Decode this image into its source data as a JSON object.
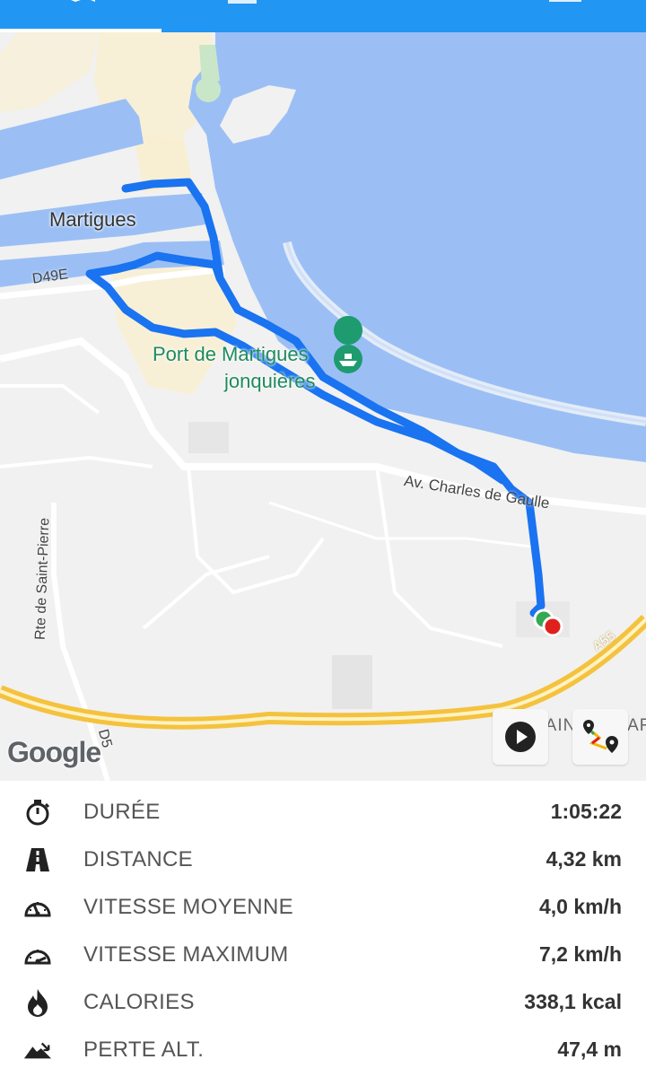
{
  "tabs": [
    {
      "icon": "map-icon"
    },
    {
      "icon": "list-icon"
    },
    {
      "icon": "chart-icon"
    },
    {
      "icon": "photo-icon"
    }
  ],
  "map": {
    "labels": {
      "martigues": "Martigues",
      "d49e": "D49E",
      "port_line1": "Port de Martigues",
      "port_line2": "jonquières",
      "avenue": "Av. Charles de Gaulle",
      "rte": "Rte de Saint-Pierre",
      "d5": "D5",
      "a55": "A55",
      "saint_lazare": "SAINT-LAZARE"
    },
    "google": "Google",
    "play_button": "play-icon",
    "route_button": "route-icon"
  },
  "stats": [
    {
      "icon": "stopwatch-icon",
      "label": "DURÉE",
      "value": "1:05:22"
    },
    {
      "icon": "road-icon",
      "label": "DISTANCE",
      "value": "4,32 km"
    },
    {
      "icon": "speedometer-icon",
      "label": "VITESSE MOYENNE",
      "value": "4,0 km/h"
    },
    {
      "icon": "speedometer-max-icon",
      "label": "VITESSE MAXIMUM",
      "value": "7,2 km/h"
    },
    {
      "icon": "flame-icon",
      "label": "CALORIES",
      "value": "338,1 kcal"
    },
    {
      "icon": "mountain-descent-icon",
      "label": "PERTE ALT.",
      "value": "47,4 m"
    }
  ],
  "colors": {
    "primary": "#2196f3",
    "route": "#1a73f0",
    "water": "#9bbff5",
    "start": "#34a853",
    "end": "#e0201b"
  }
}
